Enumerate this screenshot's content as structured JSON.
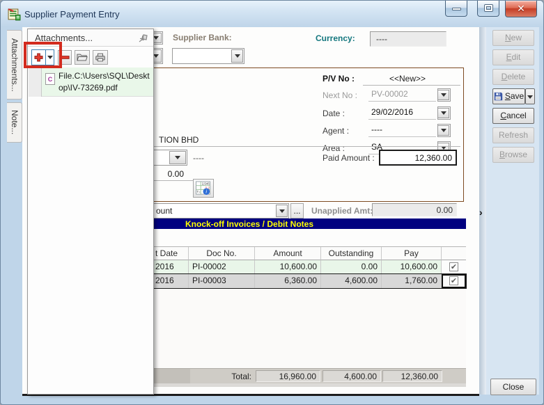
{
  "win": {
    "title": "Supplier Payment Entry"
  },
  "tabs": {
    "attachments": "Attachments...",
    "note": "Note..."
  },
  "panel": {
    "title": "Attachments...",
    "file": "File.C:\\Users\\SQL\\Desktop\\IV-73269.pdf",
    "icons": [
      "plus-icon",
      "dropdown-arrow-icon",
      "minus-icon",
      "folder-open-icon",
      "scan-icon",
      "pin-icon",
      "pdf-file-icon"
    ]
  },
  "form": {
    "supplier_bank_label": "Supplier Bank:",
    "currency_label": "Currency:",
    "currency_value": "----",
    "pv_no_label": "P/V No :",
    "pv_no_value": "<<New>>",
    "next_no_label": "Next No :",
    "next_no_value": "PV-00002",
    "date_label": "Date :",
    "date_value": "29/02/2016",
    "agent_label": "Agent :",
    "agent_value": "----",
    "area_label": "Area :",
    "area_value": "SA",
    "paid_amount_label": "Paid Amount :",
    "paid_amount_value": "12,360.00",
    "supplier_name_fragment": "TION BHD",
    "dashes_value": "----",
    "zero_amount": "0.00",
    "payment_account_fragment": "ount",
    "ellipsis_label": "...",
    "unapplied_label": "Unapplied Amt:",
    "unapplied_value": "0.00"
  },
  "knockoff": {
    "header": "Knock-off Invoices / Debit Notes"
  },
  "grid": {
    "col_date": "t Date",
    "col_doc": "Doc No.",
    "col_amount": "Amount",
    "col_outstanding": "Outstanding",
    "col_pay": "Pay",
    "rows": [
      {
        "date": "2016",
        "doc": "PI-00002",
        "amount": "10,600.00",
        "outstanding": "0.00",
        "pay": "10,600.00",
        "checked": true
      },
      {
        "date": "2016",
        "doc": "PI-00003",
        "amount": "6,360.00",
        "outstanding": "4,600.00",
        "pay": "1,760.00",
        "checked": true
      }
    ],
    "total_label": "Total:",
    "total_amount": "16,960.00",
    "total_outstanding": "4,600.00",
    "total_pay": "12,360.00"
  },
  "buttons": {
    "new": "New",
    "edit": "Edit",
    "delete": "Delete",
    "save": "Save",
    "cancel": "Cancel",
    "refresh": "Refresh",
    "browse": "Browse",
    "close": "Close"
  },
  "colors": {
    "accent_navy": "#000080",
    "header_yellow": "#ffff00",
    "teal_label": "#14777e",
    "annotation_red": "#d32b1e",
    "row_green": "#e9f6e9",
    "title_frame_blue": "#bfd5e9"
  }
}
